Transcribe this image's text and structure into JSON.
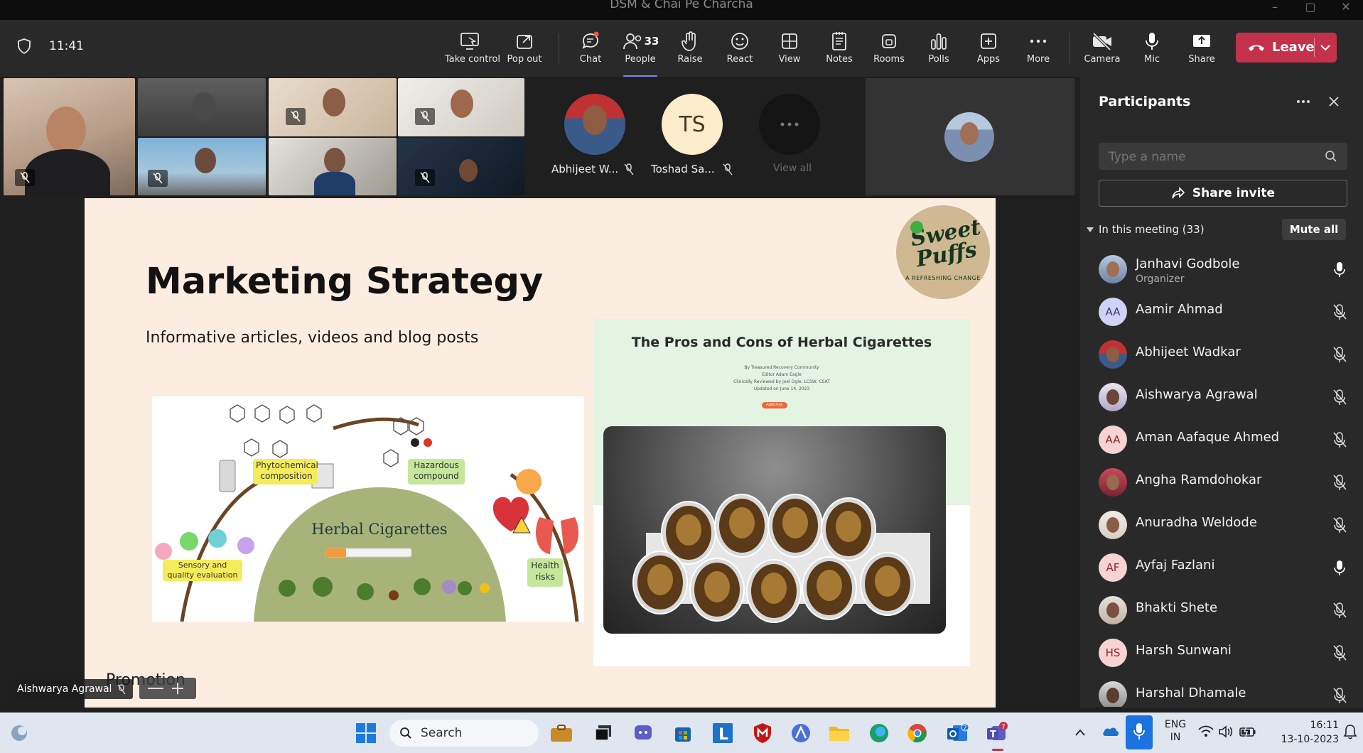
{
  "window": {
    "title": "DSM & Chai Pe Charcha"
  },
  "toolbar": {
    "time": "11:41",
    "take_control": "Take control",
    "pop_out": "Pop out",
    "chat": "Chat",
    "people": "People",
    "people_count": "33",
    "raise": "Raise",
    "react": "React",
    "view": "View",
    "notes": "Notes",
    "rooms": "Rooms",
    "polls": "Polls",
    "apps": "Apps",
    "more": "More",
    "camera": "Camera",
    "mic": "Mic",
    "share": "Share",
    "leave": "Leave"
  },
  "gallery": {
    "p1_name": "Abhijeet W...",
    "p2_initials": "TS",
    "p2_name": "Toshad Sa...",
    "view_all": "View all"
  },
  "presenter": {
    "name": "Aishwarya Agrawal"
  },
  "slide": {
    "title": "Marketing Strategy",
    "subtitle": "Informative articles, videos and blog posts",
    "footer_label": "Promotion",
    "logo_word1": "Sweet",
    "logo_word2": "Puffs",
    "logo_tag": "A REFRESHING CHANGE",
    "infographic": {
      "center": "Herbal Cigarettes",
      "label_phyto_1": "Phytochemical",
      "label_phyto_2": "composition",
      "label_haz_1": "Hazardous",
      "label_haz_2": "compound",
      "label_sens_1": "Sensory and",
      "label_sens_2": "quality evaluation",
      "label_health_1": "Health",
      "label_health_2": "risks"
    },
    "article": {
      "title": "The Pros and Cons of Herbal Cigarettes",
      "by": "By Treasured Recovery Community",
      "editor": "Editor Adam Eagle",
      "reviewed": "Clinically Reviewed by Joel Ogle, LCSW, CSAT",
      "updated": "Updated on June 14, 2023",
      "tag": "Addiction"
    }
  },
  "participants": {
    "title": "Participants",
    "search_placeholder": "Type a name",
    "share_invite": "Share invite",
    "section": "In this meeting (33)",
    "mute_all": "Mute all",
    "list": [
      {
        "name": "Janhavi Godbole",
        "role": "Organizer",
        "initials": "",
        "mic": "on"
      },
      {
        "name": "Aamir Ahmad",
        "initials": "AA",
        "mic": "off"
      },
      {
        "name": "Abhijeet Wadkar",
        "initials": "",
        "mic": "off"
      },
      {
        "name": "Aishwarya Agrawal",
        "initials": "",
        "mic": "off"
      },
      {
        "name": "Aman Aafaque Ahmed",
        "initials": "AA",
        "mic": "off"
      },
      {
        "name": "Angha Ramdohokar",
        "initials": "",
        "mic": "off"
      },
      {
        "name": "Anuradha Weldode",
        "initials": "",
        "mic": "off"
      },
      {
        "name": "Ayfaj Fazlani",
        "initials": "AF",
        "mic": "on"
      },
      {
        "name": "Bhakti Shete",
        "initials": "",
        "mic": "off"
      },
      {
        "name": "Harsh Sunwani",
        "initials": "HS",
        "mic": "off"
      },
      {
        "name": "Harshal Dhamale",
        "initials": "",
        "mic": "off"
      }
    ]
  },
  "taskbar": {
    "search": "Search",
    "lang_1": "ENG",
    "lang_2": "IN",
    "time": "16:11",
    "date": "13-10-2023",
    "teams_badge": "7",
    "notif_badge": "2"
  },
  "colors": {
    "accent": "#7f85f5",
    "leave": "#c4314b",
    "slide_bg": "#fbeee0"
  }
}
